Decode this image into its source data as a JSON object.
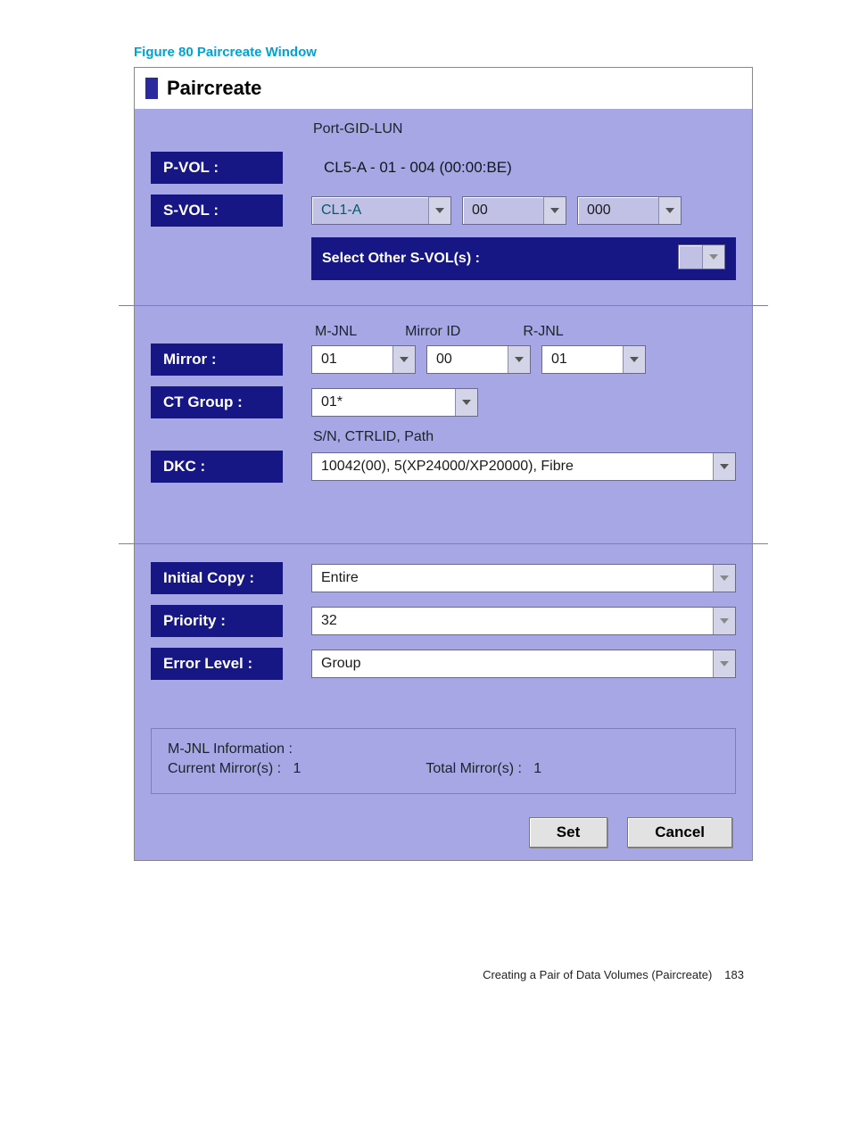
{
  "caption": "Figure 80 Paircreate Window",
  "dialog_title": "Paircreate",
  "header_port": "Port-GID-LUN",
  "pvol": {
    "label": "P-VOL :",
    "value": "CL5-A - 01 - 004 (00:00:BE)"
  },
  "svol": {
    "label": "S-VOL :",
    "port": "CL1-A",
    "gid": "00",
    "lun": "000"
  },
  "other_svol_label": "Select Other S-VOL(s) :",
  "mirror": {
    "label": "Mirror :",
    "headers": {
      "mjnl": "M-JNL",
      "mid": "Mirror ID",
      "rjnl": "R-JNL"
    },
    "mjnl": "01",
    "mid": "00",
    "rjnl": "01"
  },
  "ctgroup": {
    "label": "CT Group :",
    "value": "01*"
  },
  "dkc_header": "S/N, CTRLID, Path",
  "dkc": {
    "label": "DKC :",
    "value": "10042(00), 5(XP24000/XP20000), Fibre"
  },
  "initial_copy": {
    "label": "Initial Copy :",
    "value": "Entire"
  },
  "priority": {
    "label": "Priority :",
    "value": "32"
  },
  "error_level": {
    "label": "Error Level :",
    "value": "Group"
  },
  "mjnl_info": {
    "title": "M-JNL Information :",
    "current_label": "Current Mirror(s) :",
    "current_value": "1",
    "total_label": "Total Mirror(s) :",
    "total_value": "1"
  },
  "buttons": {
    "set": "Set",
    "cancel": "Cancel"
  },
  "footer": {
    "text": "Creating a Pair of Data Volumes (Paircreate)",
    "page": "183"
  },
  "chart_data": {
    "type": "table",
    "title": "Paircreate Window field values",
    "rows": [
      {
        "field": "P-VOL",
        "value": "CL5-A - 01 - 004 (00:00:BE)"
      },
      {
        "field": "S-VOL Port",
        "value": "CL1-A"
      },
      {
        "field": "S-VOL GID",
        "value": "00"
      },
      {
        "field": "S-VOL LUN",
        "value": "000"
      },
      {
        "field": "M-JNL",
        "value": "01"
      },
      {
        "field": "Mirror ID",
        "value": "00"
      },
      {
        "field": "R-JNL",
        "value": "01"
      },
      {
        "field": "CT Group",
        "value": "01*"
      },
      {
        "field": "DKC",
        "value": "10042(00), 5(XP24000/XP20000), Fibre"
      },
      {
        "field": "Initial Copy",
        "value": "Entire"
      },
      {
        "field": "Priority",
        "value": "32"
      },
      {
        "field": "Error Level",
        "value": "Group"
      },
      {
        "field": "Current Mirror(s)",
        "value": "1"
      },
      {
        "field": "Total Mirror(s)",
        "value": "1"
      }
    ]
  }
}
